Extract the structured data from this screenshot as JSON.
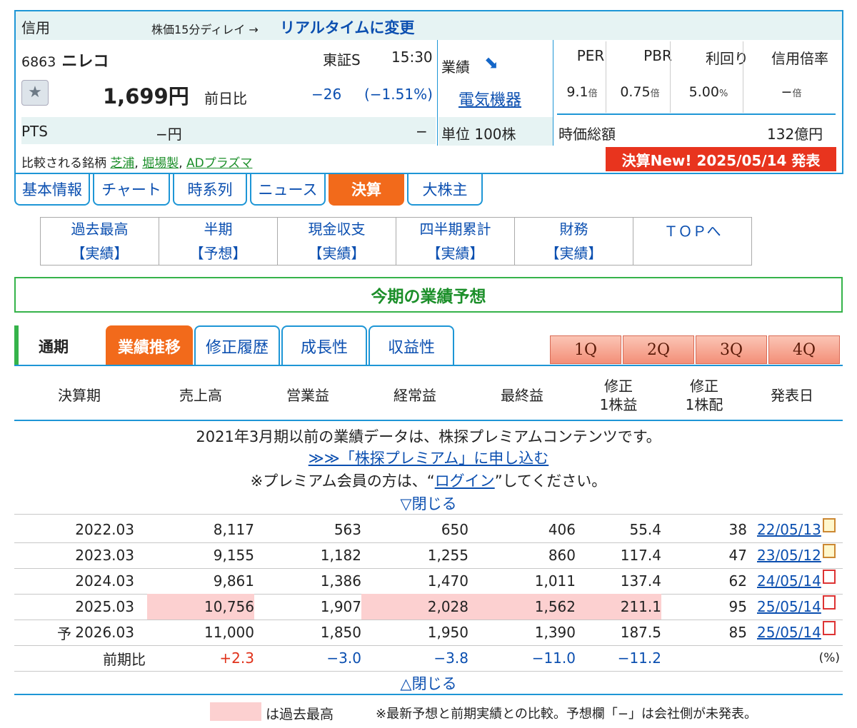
{
  "header": {
    "shinyo": "信用",
    "delay_text": "株価15分ディレイ →",
    "realtime_link": "リアルタイムに変更"
  },
  "stock": {
    "code": "6863",
    "name": "ニレコ",
    "exchange": "東証S",
    "time": "15:30",
    "price": "1,699円",
    "prev_label": "前日比",
    "change": "−26",
    "change_pct": "(−1.51%)",
    "pts_label": "PTS",
    "pts_price": "−円",
    "pts_change": "−",
    "compare_label": "比較される銘柄",
    "compare": [
      "芝浦",
      "堀場製",
      "ADプラズマ"
    ],
    "gyoseki_label": "業績",
    "sector": "電気機器",
    "unit_label": "単位",
    "unit": "100株"
  },
  "metrics": {
    "headers": [
      "PER",
      "PBR",
      "利回り",
      "信用倍率"
    ],
    "values": [
      "9.1",
      "0.75",
      "5.00",
      "−"
    ],
    "units": [
      "倍",
      "倍",
      "%",
      "倍"
    ],
    "mcap_label": "時価総額",
    "mcap": "132億円",
    "earnings_badge": "決算New!  2025/05/14  発表"
  },
  "main_tabs": [
    "基本情報",
    "チャート",
    "時系列",
    "ニュース",
    "決算",
    "大株主"
  ],
  "sub_nav": [
    {
      "top": "過去最高",
      "bottom": "【実績】"
    },
    {
      "top": "半期",
      "bottom": "【予想】"
    },
    {
      "top": "現金収支",
      "bottom": "【実績】"
    },
    {
      "top": "四半期累計",
      "bottom": "【実績】"
    },
    {
      "top": "財務",
      "bottom": "【実績】"
    },
    {
      "top": "ＴＯＰへ",
      "bottom": ""
    }
  ],
  "section_title": "今期の業績予想",
  "period_label": "通期",
  "perf_tabs": [
    "業績推移",
    "修正履歴",
    "成長性",
    "収益性"
  ],
  "quarters": [
    "1Q",
    "2Q",
    "3Q",
    "4Q"
  ],
  "table": {
    "headers": [
      "決算期",
      "売上高",
      "営業益",
      "経常益",
      "最終益",
      "修正\n1株益",
      "修正\n1株配",
      "発表日"
    ],
    "premium_msg": "2021年3月期以前の業績データは、株探プレミアムコンテンツです。",
    "premium_link": "≫≫「株探プレミアム」に申し込む",
    "login_pre": "※プレミアム会員の方は、“",
    "login_link": "ログイン",
    "login_post": "”してください。",
    "close_top": "▽閉じる",
    "rows": [
      {
        "prefix": "",
        "period": "2022.03",
        "sales": "8,117",
        "op": "563",
        "ord": "650",
        "net": "406",
        "eps": "55.4",
        "div": "38",
        "date": "22/05/13"
      },
      {
        "prefix": "",
        "period": "2023.03",
        "sales": "9,155",
        "op": "1,182",
        "ord": "1,255",
        "net": "860",
        "eps": "117.4",
        "div": "47",
        "date": "23/05/12"
      },
      {
        "prefix": "",
        "period": "2024.03",
        "sales": "9,861",
        "op": "1,386",
        "ord": "1,470",
        "net": "1,011",
        "eps": "137.4",
        "div": "62",
        "date": "24/05/14"
      },
      {
        "prefix": "",
        "period": "2025.03",
        "sales": "10,756",
        "op": "1,907",
        "ord": "2,028",
        "net": "1,562",
        "eps": "211.1",
        "div": "95",
        "date": "25/05/14"
      },
      {
        "prefix": "予",
        "period": "2026.03",
        "sales": "11,000",
        "op": "1,850",
        "ord": "1,950",
        "net": "1,390",
        "eps": "187.5",
        "div": "85",
        "date": "25/05/14"
      }
    ],
    "yoy": {
      "label": "前期比",
      "sales": "+2.3",
      "op": "−3.0",
      "ord": "−3.8",
      "net": "−11.0",
      "eps": "−11.2",
      "unit": "(%)"
    },
    "close_bottom": "△閉じる"
  },
  "legend": {
    "text": "は過去最高",
    "note": "※最新予想と前期実績との比較。予想欄「−」は会社側が未発表。",
    "highlight_color": "#fcd0d0"
  },
  "colors": {
    "accent": "#1e96d6",
    "active_tab": "#f26a1b",
    "green": "#35b34a",
    "badge": "#e8341e"
  }
}
